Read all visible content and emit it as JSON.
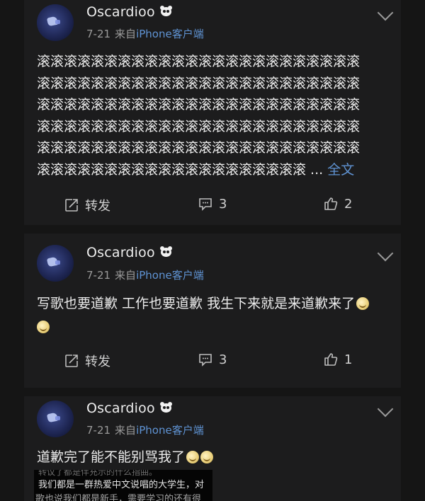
{
  "posts": [
    {
      "user": "Oscardioo",
      "date": "7-21",
      "source_prefix": "来自",
      "device": "iPhone客户端",
      "lines": [
        "滚滚滚滚滚滚滚滚滚滚滚滚滚滚滚滚滚滚滚滚滚滚滚滚",
        "滚滚滚滚滚滚滚滚滚滚滚滚滚滚滚滚滚滚滚滚滚滚滚滚",
        "滚滚滚滚滚滚滚滚滚滚滚滚滚滚滚滚滚滚滚滚滚滚滚滚",
        "滚滚滚滚滚滚滚滚滚滚滚滚滚滚滚滚滚滚滚滚滚滚滚滚",
        "滚滚滚滚滚滚滚滚滚滚滚滚滚滚滚滚滚滚滚滚滚滚滚滚",
        "滚滚滚滚滚滚滚滚滚滚滚滚滚滚滚滚滚滚滚滚"
      ],
      "ellipsis": " ... ",
      "more_label": "全文",
      "repost_label": "转发",
      "comment_count": "3",
      "like_count": "2"
    },
    {
      "user": "Oscardioo",
      "date": "7-21",
      "source_prefix": "来自",
      "device": "iPhone客户端",
      "text": "写歌也要道歉 工作也要道歉 我生下来就是来道歉来了",
      "emoji": "doge-emoji",
      "repost_label": "转发",
      "comment_count": "3",
      "like_count": "1"
    },
    {
      "user": "Oscardioo",
      "date": "7-21",
      "source_prefix": "来自",
      "device": "iPhone客户端",
      "text": "道歉完了能不能别骂我了",
      "emoji": "laugh-cry-emoji"
    }
  ],
  "snippet": {
    "line1": "转议了都是伴充示的什么指曲。",
    "line2": "我们都是一群热爱中文说唱的大学生，对",
    "line3": "歌也说我们都是新手，需要学习的还有很"
  },
  "colors": {
    "background": "#151515",
    "card": "#1c1c1d",
    "link": "#5f93d3",
    "meta": "#9a9a9a"
  }
}
